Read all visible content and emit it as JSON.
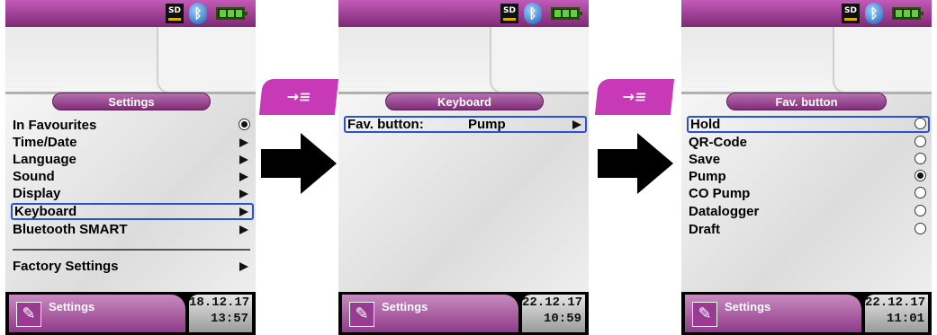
{
  "status": {
    "sd_label": "SD"
  },
  "screens": [
    {
      "title": "Settings",
      "rows": [
        {
          "label": "In Favourites",
          "value": "",
          "control": "radio-on"
        },
        {
          "label": "Time/Date",
          "value": "",
          "control": "arrow"
        },
        {
          "label": "Language",
          "value": "",
          "control": "arrow"
        },
        {
          "label": "Sound",
          "value": "",
          "control": "arrow"
        },
        {
          "label": "Display",
          "value": "",
          "control": "arrow"
        },
        {
          "label": "Keyboard",
          "value": "",
          "control": "arrow",
          "selected": true
        },
        {
          "label": "Bluetooth SMART",
          "value": "",
          "control": "arrow"
        },
        {
          "label": "Factory Settings",
          "value": "",
          "control": "arrow"
        }
      ],
      "footer": {
        "label": "Settings",
        "date": "18.12.17",
        "time": "13:57"
      }
    },
    {
      "title": "Keyboard",
      "rows": [
        {
          "label": "Fav. button:",
          "value": "Pump",
          "control": "arrow",
          "selected": true
        }
      ],
      "footer": {
        "label": "Settings",
        "date": "22.12.17",
        "time": "10:59"
      }
    },
    {
      "title": "Fav. button",
      "rows": [
        {
          "label": "Hold",
          "control": "radio-off",
          "selected": true
        },
        {
          "label": "QR-Code",
          "control": "radio-off"
        },
        {
          "label": "Save",
          "control": "radio-off"
        },
        {
          "label": "Pump",
          "control": "radio-on"
        },
        {
          "label": "CO Pump",
          "control": "radio-off"
        },
        {
          "label": "Datalogger",
          "control": "radio-off"
        },
        {
          "label": "Draft",
          "control": "radio-off"
        }
      ],
      "footer": {
        "label": "Settings",
        "date": "22.12.17",
        "time": "11:01"
      }
    }
  ],
  "softkey": {
    "glyph": "→≡"
  },
  "colors": {
    "accent": "#c739b7",
    "selection": "#2e4fd0"
  }
}
